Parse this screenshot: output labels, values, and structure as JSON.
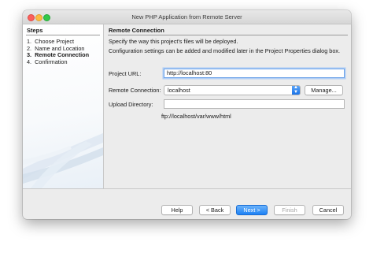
{
  "window": {
    "title": "New PHP Application from Remote Server"
  },
  "steps": {
    "title": "Steps",
    "items": [
      {
        "num": "1.",
        "label": "Choose Project"
      },
      {
        "num": "2.",
        "label": "Name and Location"
      },
      {
        "num": "3.",
        "label": "Remote Connection"
      },
      {
        "num": "4.",
        "label": "Confirmation"
      }
    ]
  },
  "main": {
    "title": "Remote Connection",
    "desc1": "Specify the way this project's files will be deployed.",
    "desc2": "Configuration settings can be added and modified later in the Project Properties dialog box.",
    "project_url_label": "Project URL:",
    "project_url_value": "http://localhost:80",
    "remote_connection_label": "Remote Connection:",
    "remote_connection_value": "localhost",
    "manage_label": "Manage...",
    "upload_dir_label": "Upload Directory:",
    "upload_dir_value": "",
    "upload_path_hint": "ftp://localhost/var/www/html"
  },
  "buttons": {
    "help": "Help",
    "back": "< Back",
    "next": "Next >",
    "finish": "Finish",
    "cancel": "Cancel"
  }
}
